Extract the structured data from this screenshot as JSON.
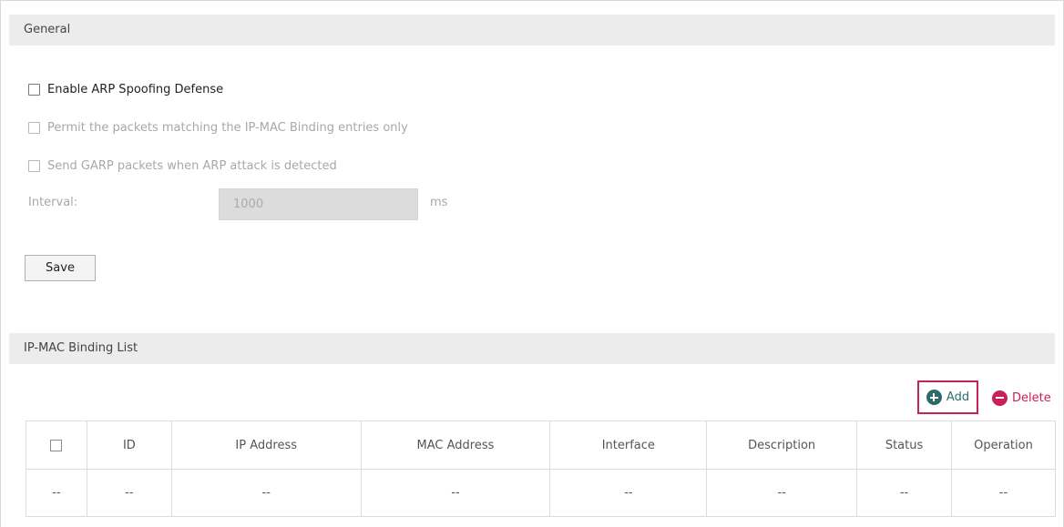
{
  "general": {
    "header": "General",
    "enable_arp_label": "Enable ARP Spoofing Defense",
    "permit_label": "Permit the packets matching the IP-MAC Binding entries only",
    "garp_label": "Send GARP packets when ARP attack is detected",
    "interval_label": "Interval:",
    "interval_value": "1000",
    "interval_unit": "ms",
    "save_label": "Save"
  },
  "binding_list": {
    "header": "IP-MAC Binding List",
    "add_label": "Add",
    "delete_label": "Delete",
    "columns": [
      "ID",
      "IP Address",
      "MAC Address",
      "Interface",
      "Description",
      "Status",
      "Operation"
    ],
    "empty_row": [
      "--",
      "--",
      "--",
      "--",
      "--",
      "--",
      "--",
      "--"
    ]
  },
  "colors": {
    "accent": "#c8205a",
    "add_icon": "#2e6a6a"
  }
}
